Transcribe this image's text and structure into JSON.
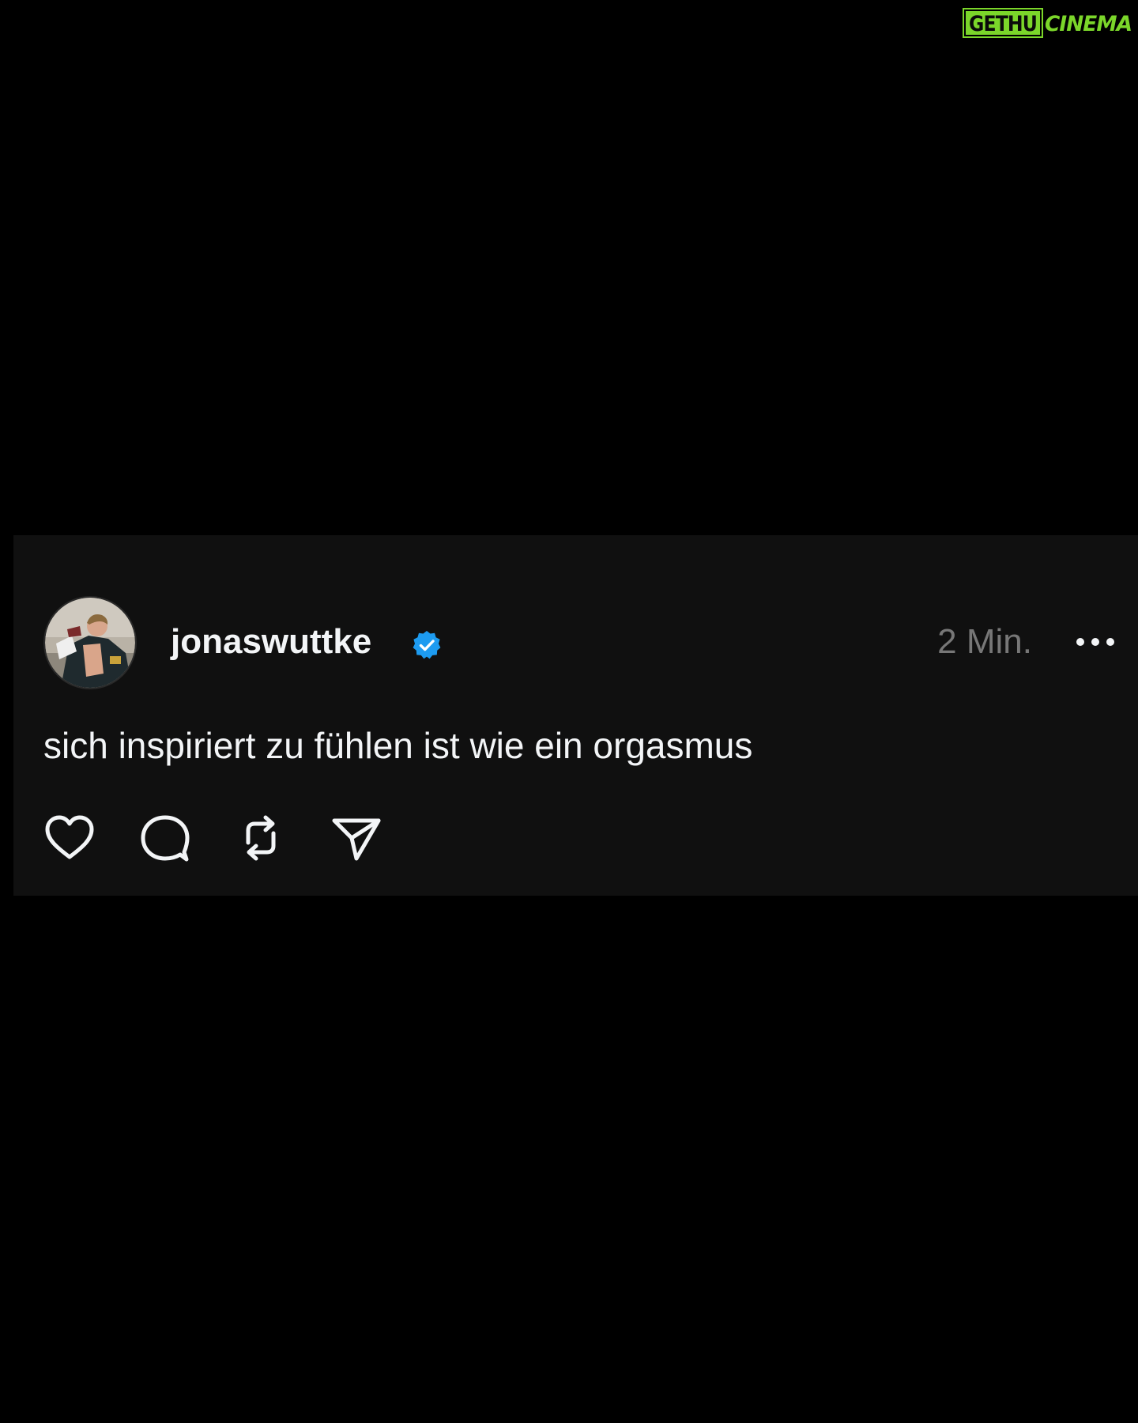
{
  "watermark": {
    "text_left": "GETHU",
    "text_right": "CINEMA",
    "color": "#7bd62a"
  },
  "post": {
    "author": {
      "username": "jonaswuttke",
      "verified": true,
      "verified_color": "#1d9bf0",
      "avatar_icon": "profile-photo"
    },
    "timestamp": "2 Min.",
    "text": "sich inspiriert zu fühlen ist wie ein orgasmus",
    "actions": [
      {
        "name": "like",
        "icon": "heart-icon"
      },
      {
        "name": "reply",
        "icon": "comment-icon"
      },
      {
        "name": "repost",
        "icon": "repost-icon"
      },
      {
        "name": "share",
        "icon": "send-icon"
      }
    ],
    "more_icon": "more-options-icon"
  },
  "colors": {
    "background": "#000000",
    "card": "#101010",
    "text": "#f3f5f7",
    "muted": "#777777"
  }
}
